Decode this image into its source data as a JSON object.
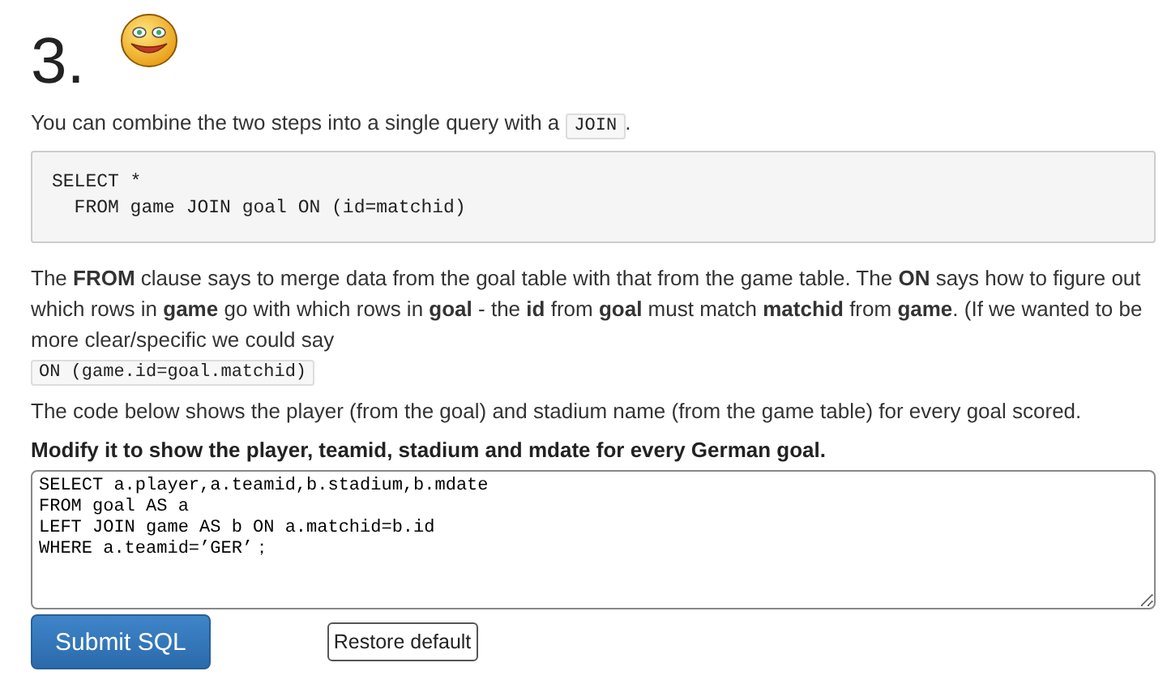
{
  "heading": {
    "number": "3."
  },
  "intro": {
    "text": "You can combine the two steps into a single query with a",
    "code": "JOIN",
    "end": "."
  },
  "code_block": [
    "SELECT *",
    "  FROM game JOIN goal ON (id=matchid)"
  ],
  "explanation": {
    "text": "The **FROM** clause says to merge data from the goal table with that from the game table. The **ON** says how to figure out which rows in **game** go with which rows in **goal** - the **id** from **goal** must match **matchid** from **game**. (If we wanted to be more clear/specific we could say",
    "code": "ON (game.id=goal.matchid)"
  },
  "description": "The code below shows the player (from the goal) and stadium name (from the game table) for every goal scored.",
  "task": "Modify it to show the player, teamid, stadium and mdate for every German goal.",
  "query": "SELECT a.player,a.teamid,b.stadium,b.mdate\nFROM goal AS a\nLEFT JOIN game AS b ON a.matchid=b.id\nWHERE a.teamid=’GER’；",
  "buttons": [
    {
      "kind": "primary",
      "label": "Submit SQL"
    },
    {
      "kind": "secondary",
      "label": "Restore default"
    }
  ]
}
